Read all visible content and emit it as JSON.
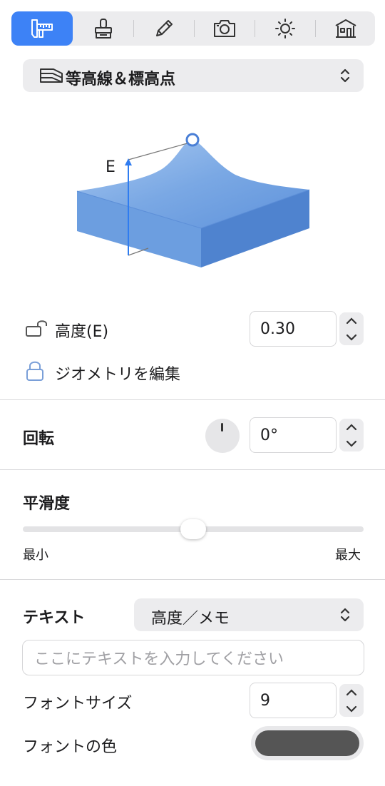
{
  "toolbar": {
    "tabs": [
      {
        "name": "measure",
        "icon": "caliper-ruler-icon",
        "active": true
      },
      {
        "name": "style",
        "icon": "brush-stamp-icon",
        "active": false
      },
      {
        "name": "edit",
        "icon": "pencil-icon",
        "active": false
      },
      {
        "name": "camera",
        "icon": "camera-icon",
        "active": false
      },
      {
        "name": "light",
        "icon": "sun-icon",
        "active": false
      },
      {
        "name": "building",
        "icon": "building-icon",
        "active": false
      }
    ]
  },
  "mode_select": {
    "label": "等高線＆標高点",
    "icon": "contour-layers-icon"
  },
  "diagram": {
    "axis_label": "E"
  },
  "height": {
    "label": "高度(E)",
    "value": "0.30",
    "lock_icon": "unlock-icon"
  },
  "edit_geometry": {
    "label": "ジオメトリを編集",
    "icon": "lock-icon"
  },
  "rotation": {
    "label": "回転",
    "value": "0°",
    "dial_fraction": 0
  },
  "smoothness": {
    "label": "平滑度",
    "min_label": "最小",
    "max_label": "最大",
    "value_fraction": 0.5
  },
  "text": {
    "label": "テキスト",
    "select_value": "高度／メモ",
    "input_placeholder": "ここにテキストを入力してください",
    "font_size_label": "フォントサイズ",
    "font_size_value": "9",
    "font_color_label": "フォントの色",
    "font_color": "#555555"
  },
  "colors": {
    "accent": "#3d82f6",
    "terrain": "#5a8fd6"
  }
}
